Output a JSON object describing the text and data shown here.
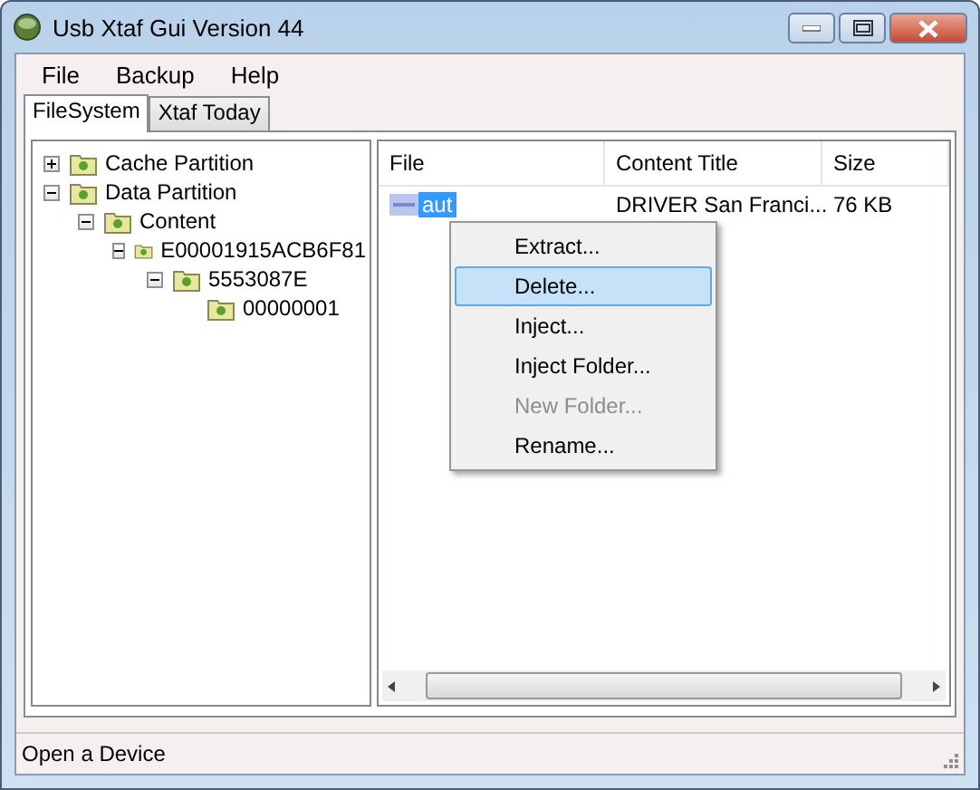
{
  "window": {
    "title": "Usb Xtaf Gui Version 44"
  },
  "menu": [
    "File",
    "Backup",
    "Help"
  ],
  "tabs": [
    {
      "label": "FileSystem",
      "selected": true
    },
    {
      "label": "Xtaf Today",
      "selected": false
    }
  ],
  "tree": [
    {
      "label": "Cache Partition",
      "expanded": false
    },
    {
      "label": "Data Partition",
      "expanded": true,
      "children": [
        {
          "label": "Content",
          "expanded": true,
          "children": [
            {
              "label": "E00001915ACB6F81",
              "expanded": true,
              "children": [
                {
                  "label": "5553087E",
                  "expanded": true,
                  "children": [
                    {
                      "label": "00000001"
                    }
                  ]
                }
              ]
            }
          ]
        }
      ]
    }
  ],
  "table": {
    "columns": [
      "File",
      "Content Title",
      "Size"
    ],
    "rows": [
      {
        "file": "aut",
        "content_title": "DRIVER San Franci...",
        "size": "76 KB",
        "selected": true
      }
    ]
  },
  "context_menu": [
    {
      "label": "Extract...",
      "selected": false,
      "disabled": false
    },
    {
      "label": "Delete...",
      "selected": true,
      "disabled": false
    },
    {
      "label": "Inject...",
      "selected": false,
      "disabled": false
    },
    {
      "label": "Inject Folder...",
      "selected": false,
      "disabled": false
    },
    {
      "label": "New Folder...",
      "selected": false,
      "disabled": true
    },
    {
      "label": "Rename...",
      "selected": false,
      "disabled": false
    }
  ],
  "status_bar": "Open a Device"
}
